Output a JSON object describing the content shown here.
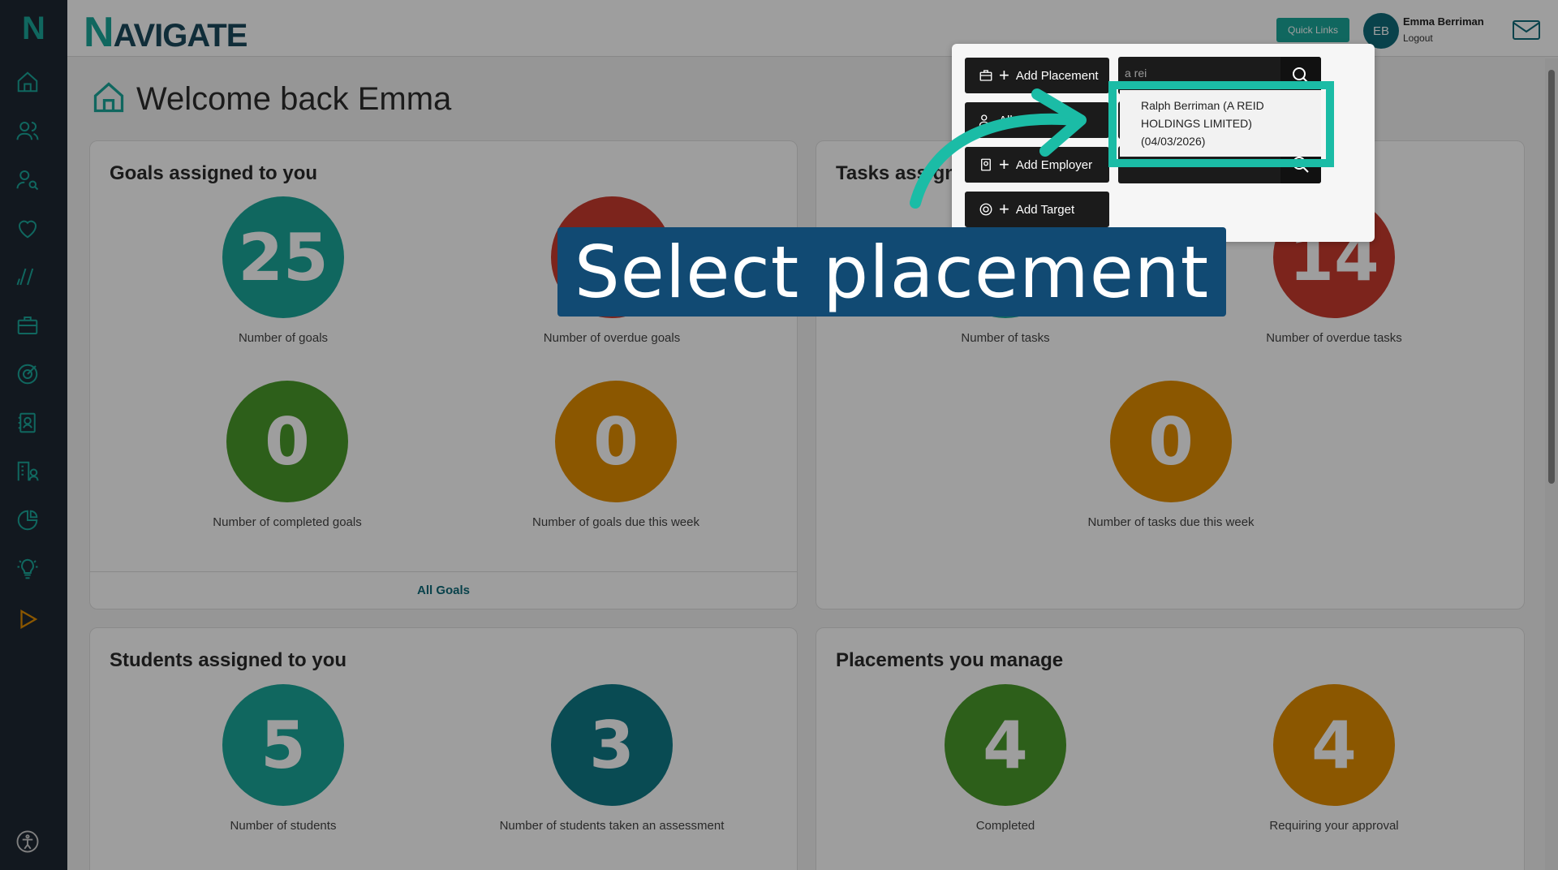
{
  "brand": {
    "name": "NAVIGATE",
    "logo_letter": "N"
  },
  "header": {
    "quick_links_label": "Quick Links",
    "user_initials": "EB",
    "user_name": "Emma Berriman",
    "logout_label": "Logout"
  },
  "page": {
    "title": "Welcome back Emma"
  },
  "goals_card": {
    "title": "Goals assigned to you",
    "stats": [
      {
        "value": "25",
        "label": "Number of goals",
        "color": "#1aa79a"
      },
      {
        "value": "",
        "label": "Number of overdue goals",
        "color": "#c83a2e"
      },
      {
        "value": "0",
        "label": "Number of completed goals",
        "color": "#4a9a2a"
      },
      {
        "value": "0",
        "label": "Number of goals due this week",
        "color": "#e08d00"
      }
    ],
    "footer": "All Goals"
  },
  "tasks_card": {
    "title": "Tasks assigned",
    "stats": [
      {
        "value": "",
        "label": "Number of tasks",
        "color": "#1aa79a"
      },
      {
        "value": "14",
        "label": "Number of overdue tasks",
        "color": "#c83a2e"
      },
      {
        "value": "0",
        "label": "Number of tasks due this week",
        "color": "#e08d00"
      }
    ]
  },
  "students_card": {
    "title": "Students assigned to you",
    "stats": [
      {
        "value": "5",
        "label": "Number of students",
        "color": "#1aa79a"
      },
      {
        "value": "3",
        "label": "Number of students taken an assessment",
        "color": "#0f7a86"
      }
    ]
  },
  "placements_card": {
    "title": "Placements you manage",
    "stats": [
      {
        "value": "4",
        "label": "Completed",
        "color": "#4a9a2a"
      },
      {
        "value": "4",
        "label": "Requiring your approval",
        "color": "#e08d00"
      }
    ]
  },
  "quick_links_popup": {
    "buttons": [
      {
        "label": "Add Placement",
        "icon": "briefcase-icon"
      },
      {
        "label": "All Students",
        "icon": "users-icon"
      },
      {
        "label": "Add Employer",
        "icon": "contact-card-icon"
      },
      {
        "label": "Add Target",
        "icon": "target-icon"
      }
    ],
    "search_value": "a rei"
  },
  "dropdown_result": {
    "line1": "Ralph Berriman (A REID",
    "line2": "HOLDINGS LIMITED)",
    "line3": "(04/03/2026)"
  },
  "callout": {
    "text": "Select placement",
    "highlight_color": "#1bbca6",
    "banner_color": "#114a73"
  }
}
